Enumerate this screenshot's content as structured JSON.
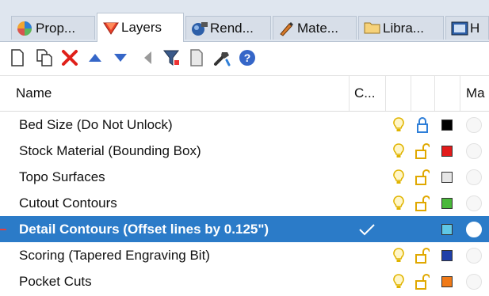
{
  "tabs": [
    {
      "label": "Prop...",
      "icon": "properties-icon",
      "active": false
    },
    {
      "label": "Layers",
      "icon": "layers-icon",
      "active": true
    },
    {
      "label": "Rend...",
      "icon": "rendering-icon",
      "active": false
    },
    {
      "label": "Mate...",
      "icon": "materials-icon",
      "active": false
    },
    {
      "label": "Libra...",
      "icon": "libraries-folder-icon",
      "active": false
    },
    {
      "label": "H",
      "icon": "help-panel-icon",
      "active": false
    }
  ],
  "toolbar": {
    "icons": [
      "new-layer-icon",
      "new-sublayer-icon",
      "delete-icon",
      "move-up-icon",
      "move-down-icon",
      "move-out-icon",
      "filter-icon",
      "copy-layers-icon",
      "tools-icon",
      "help-icon"
    ]
  },
  "columns": {
    "name": "Name",
    "current": "C...",
    "material": "Ma"
  },
  "layers": [
    {
      "name": "Bed Size (Do Not Unlock)",
      "current": false,
      "visible": true,
      "locked": true,
      "color": "#000000",
      "selected": false
    },
    {
      "name": "Stock Material (Bounding Box)",
      "current": false,
      "visible": true,
      "locked": false,
      "color": "#e21b1b",
      "selected": false
    },
    {
      "name": "Topo Surfaces",
      "current": false,
      "visible": true,
      "locked": false,
      "color": "#e6e6e6",
      "selected": false
    },
    {
      "name": "Cutout Contours",
      "current": false,
      "visible": true,
      "locked": false,
      "color": "#49b83a",
      "selected": false
    },
    {
      "name": "Detail Contours (Offset lines by 0.125\")",
      "current": true,
      "visible": false,
      "locked": false,
      "color": "#5fc7e6",
      "selected": true
    },
    {
      "name": "Scoring (Tapered Engraving Bit)",
      "current": false,
      "visible": true,
      "locked": false,
      "color": "#1f3fa8",
      "selected": false
    },
    {
      "name": "Pocket Cuts",
      "current": false,
      "visible": true,
      "locked": false,
      "color": "#f07a18",
      "selected": false
    }
  ],
  "colors": {
    "selection": "#2b7bc8",
    "tabbar": "#dfe6ef",
    "bulb": "#e0b400",
    "lock_closed": "#2f7fd8",
    "lock_open": "#e0a800"
  }
}
